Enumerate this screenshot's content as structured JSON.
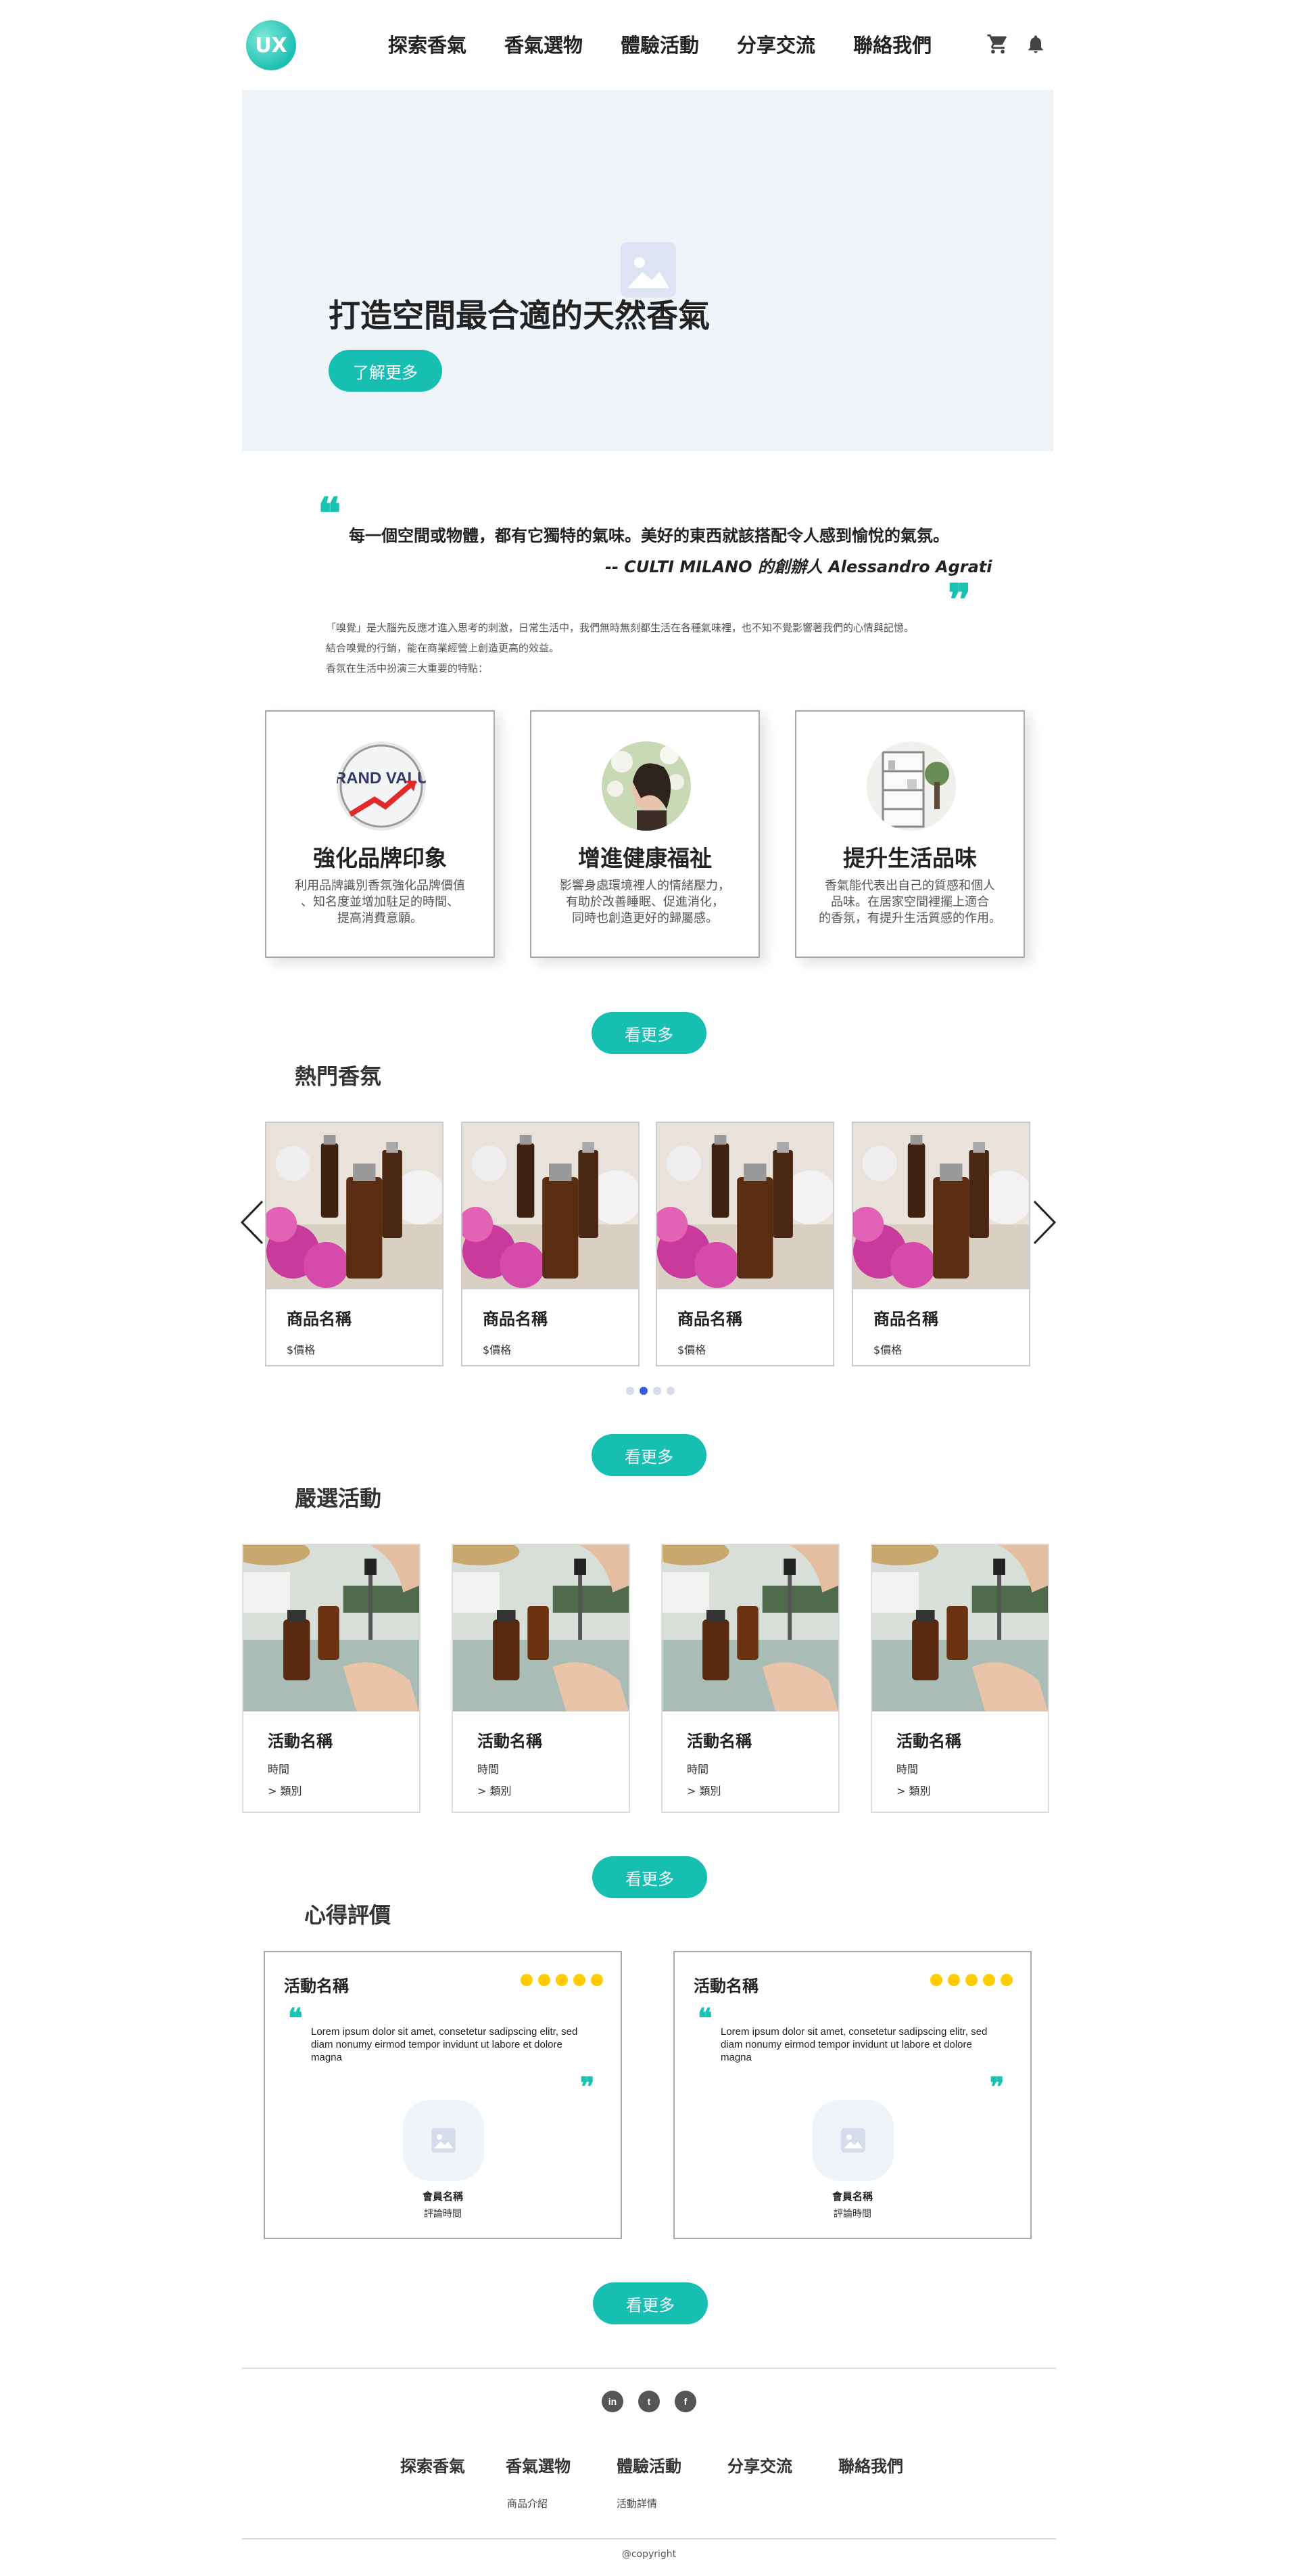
{
  "header": {
    "logo_text": "UX",
    "nav": [
      "探索香氣",
      "香氣選物",
      "體驗活動",
      "分享交流",
      "聯絡我們"
    ],
    "cart_icon": "cart-icon",
    "bell_icon": "bell-icon"
  },
  "hero": {
    "title": "打造空間最合適的天然香氣",
    "button": "了解更多"
  },
  "quote": {
    "text": "每一個空間或物體，都有它獨特的氣味。美好的東西就該搭配令人感到愉悅的氣氛。",
    "author": "-- CULTI MILANO 的創辦人 Alessandro Agrati",
    "intro_lines": [
      "「嗅覺」是大腦先反應才進入思考的刺激，日常生活中，我們無時無刻都生活在各種氣味裡，也不知不覺影響著我們的心情與記憶。",
      "結合嗅覺的行銷，能在商業經營上創造更高的效益。",
      "香氛在生活中扮演三大重要的特點："
    ]
  },
  "features": [
    {
      "title": "強化品牌印象",
      "desc": "利用品牌識別香氛強化品牌價值\n、知名度並增加駐足的時間、\n提高消費意願。",
      "image_label": "BRAND VALUE"
    },
    {
      "title": "增進健康福祉",
      "desc": "影響身處環境裡人的情緒壓力，\n有助於改善睡眠、促進消化，\n同時也創造更好的歸屬感。"
    },
    {
      "title": "提升生活品味",
      "desc": "香氣能代表出自己的質感和個人\n品味。在居家空間裡擺上適合\n的香氛，有提升生活質感的作用。"
    }
  ],
  "more_label": "看更多",
  "products": {
    "title": "熱門香氛",
    "items": [
      {
        "name": "商品名稱",
        "price": "$價格"
      },
      {
        "name": "商品名稱",
        "price": "$價格"
      },
      {
        "name": "商品名稱",
        "price": "$價格"
      },
      {
        "name": "商品名稱",
        "price": "$價格"
      }
    ],
    "dots": 4,
    "active_dot": 1
  },
  "activities": {
    "title": "嚴選活動",
    "items": [
      {
        "name": "活動名稱",
        "time": "時間",
        "category": "> 類別"
      },
      {
        "name": "活動名稱",
        "time": "時間",
        "category": "> 類別"
      },
      {
        "name": "活動名稱",
        "time": "時間",
        "category": "> 類別"
      },
      {
        "name": "活動名稱",
        "time": "時間",
        "category": "> 類別"
      }
    ]
  },
  "reviews": {
    "title": "心得評價",
    "items": [
      {
        "name": "活動名稱",
        "stars": 5,
        "text": "Lorem ipsum dolor sit amet, consetetur sadipscing elitr, sed diam nonumy eirmod tempor invidunt ut labore et dolore magna",
        "member": "會員名稱",
        "time": "評論時間"
      },
      {
        "name": "活動名稱",
        "stars": 5,
        "text": "Lorem ipsum dolor sit amet, consetetur sadipscing elitr, sed diam nonumy eirmod tempor invidunt ut labore et dolore magna",
        "member": "會員名稱",
        "time": "評論時間"
      }
    ]
  },
  "footer": {
    "social": [
      "in",
      "t",
      "f"
    ],
    "nav": [
      "探索香氣",
      "香氣選物",
      "體驗活動",
      "分享交流",
      "聯絡我們"
    ],
    "sub": [
      "商品介紹",
      "活動詳情"
    ],
    "copyright": "@copyright"
  },
  "colors": {
    "accent": "#17bfb2",
    "star": "#ffcc00",
    "hero_bg": "#eff4f9"
  }
}
